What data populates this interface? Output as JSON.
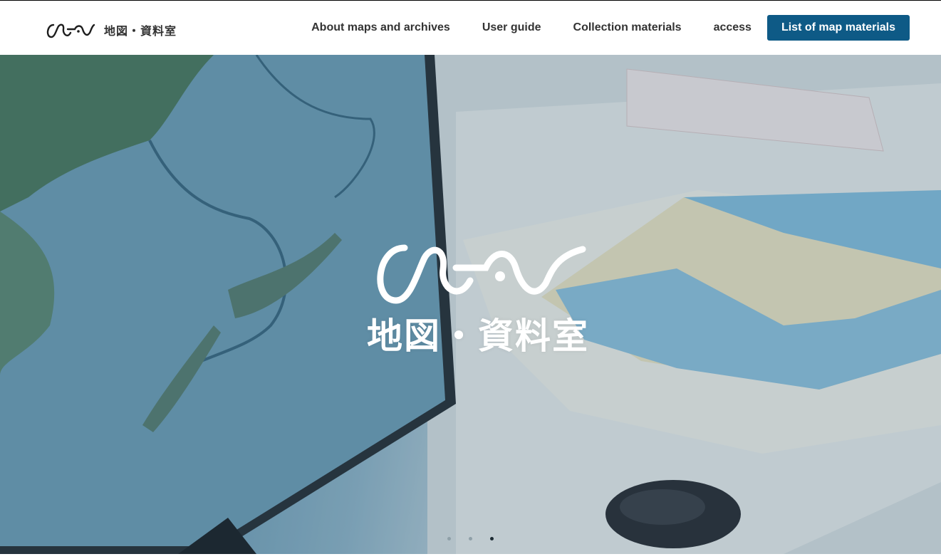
{
  "header": {
    "logo_text": "CEAS",
    "brand_jp": "地図・資料室"
  },
  "nav": {
    "items": [
      {
        "label": "About maps and archives"
      },
      {
        "label": "User guide"
      },
      {
        "label": "Collection materials"
      },
      {
        "label": "access"
      }
    ],
    "cta_label": "List of map materials",
    "cta_color": "#0e5a86"
  },
  "hero": {
    "logo_text": "CEAS",
    "title_jp": "地図・資料室",
    "carousel": {
      "count": 3,
      "active": 3
    }
  },
  "icons": [
    "ceas-logo-icon"
  ]
}
